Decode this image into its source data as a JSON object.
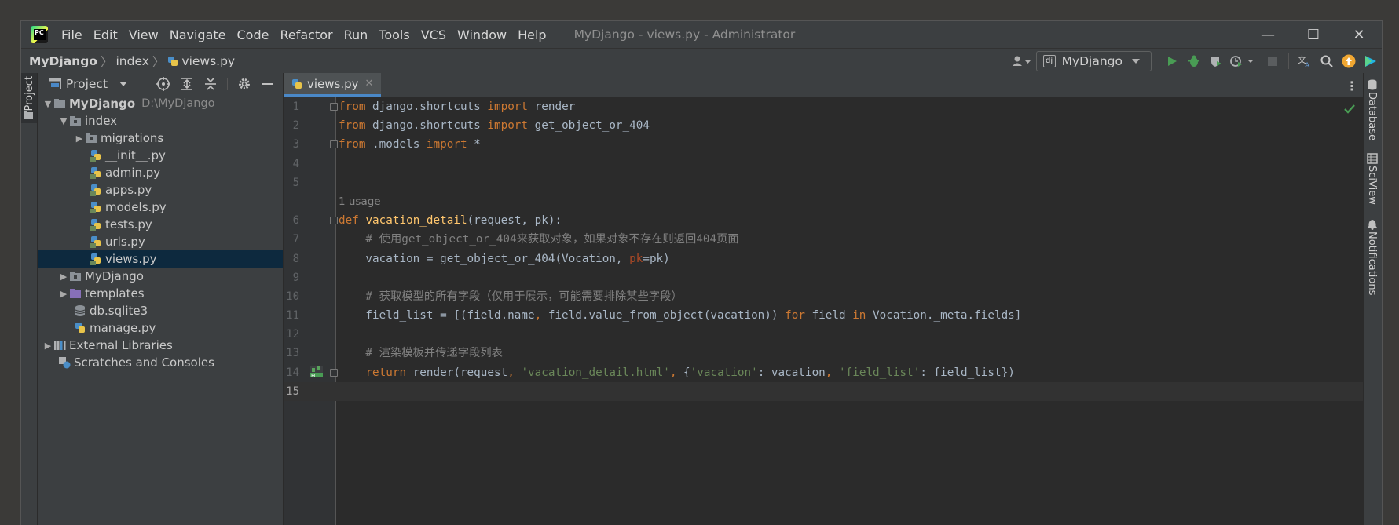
{
  "menu": [
    "File",
    "Edit",
    "View",
    "Navigate",
    "Code",
    "Refactor",
    "Run",
    "Tools",
    "VCS",
    "Window",
    "Help"
  ],
  "window_title": "MyDjango - views.py - Administrator",
  "window_controls": {
    "minimize": "—",
    "maximize": "☐",
    "close": "✕"
  },
  "breadcrumbs": {
    "root": "MyDjango",
    "folder": "index",
    "file": "views.py"
  },
  "run_config": {
    "icon": "dj",
    "label": "MyDjango"
  },
  "left_stripe": {
    "project_label": "Project"
  },
  "project_panel": {
    "title": "Project",
    "tree": [
      {
        "label": "MyDjango",
        "path": "D:\\MyDjango"
      },
      {
        "label": "index"
      },
      {
        "label": "migrations"
      },
      {
        "label": "__init__.py"
      },
      {
        "label": "admin.py"
      },
      {
        "label": "apps.py"
      },
      {
        "label": "models.py"
      },
      {
        "label": "tests.py"
      },
      {
        "label": "urls.py"
      },
      {
        "label": "views.py"
      },
      {
        "label": "MyDjango"
      },
      {
        "label": "templates"
      },
      {
        "label": "db.sqlite3"
      },
      {
        "label": "manage.py"
      },
      {
        "label": "External Libraries"
      },
      {
        "label": "Scratches and Consoles"
      }
    ]
  },
  "editor": {
    "tab_label": "views.py",
    "tab_close": "✕",
    "usage_hint": "1 usage",
    "line_numbers": [
      "1",
      "2",
      "3",
      "4",
      "5",
      "6",
      "7",
      "8",
      "9",
      "10",
      "11",
      "12",
      "13",
      "14",
      "15"
    ]
  },
  "right_stripe": {
    "items": [
      "Database",
      "SciView",
      "Notifications"
    ]
  },
  "colors": {
    "keyword": "#cc7832",
    "function": "#ffc66d",
    "comment": "#808080",
    "string": "#6a8759",
    "param": "#aa4926",
    "selection": "#0d293e"
  }
}
